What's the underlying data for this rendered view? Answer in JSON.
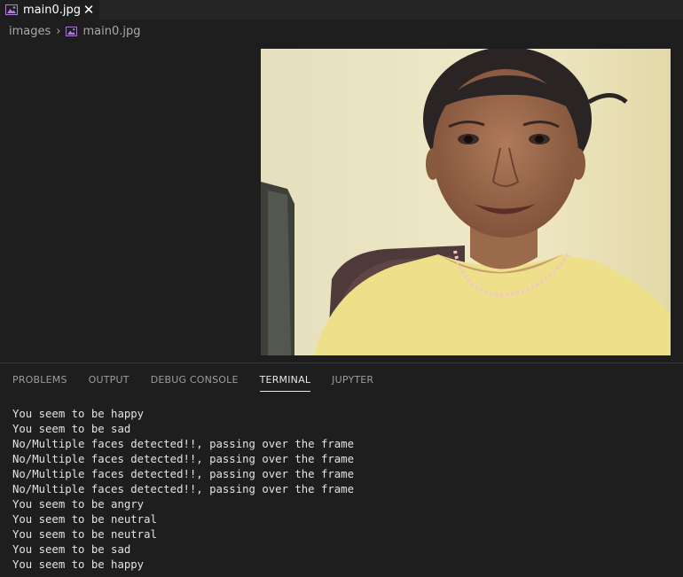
{
  "editor": {
    "tab": {
      "label": "main0.jpg",
      "icon": "image-file-icon",
      "close_icon": "close-icon"
    },
    "breadcrumb": {
      "folder": "images",
      "separator_icon": "chevron-right-icon",
      "file_icon": "image-file-icon",
      "file": "main0.jpg"
    },
    "image_preview": {
      "icon": "photo-preview"
    }
  },
  "panel": {
    "tabs": [
      {
        "label": "PROBLEMS"
      },
      {
        "label": "OUTPUT"
      },
      {
        "label": "DEBUG CONSOLE"
      },
      {
        "label": "TERMINAL",
        "active": true
      },
      {
        "label": "JUPYTER"
      }
    ],
    "terminal_lines": [
      "You seem to be happy",
      "You seem to be sad",
      "No/Multiple faces detected!!, passing over the frame",
      "No/Multiple faces detected!!, passing over the frame",
      "No/Multiple faces detected!!, passing over the frame",
      "No/Multiple faces detected!!, passing over the frame",
      "You seem to be angry",
      "You seem to be neutral",
      "You seem to be neutral",
      "You seem to be sad",
      "You seem to be happy"
    ]
  },
  "colors": {
    "background": "#1e1e1e",
    "tabbar": "#252526",
    "image_icon": "#b180d7",
    "text": "#cccccc"
  }
}
